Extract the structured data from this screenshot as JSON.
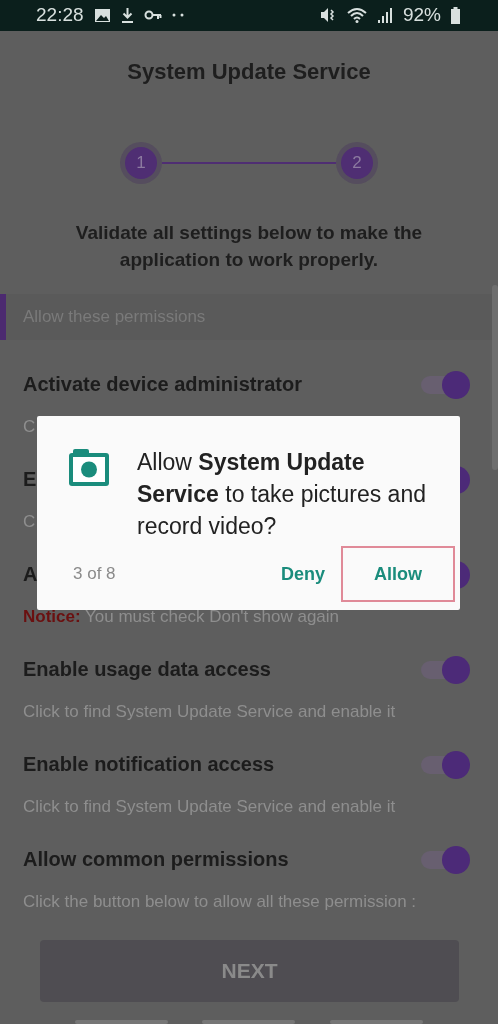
{
  "status_bar": {
    "time": "22:28",
    "battery": "92%"
  },
  "app_title": "System Update Service",
  "steps": [
    "1",
    "2"
  ],
  "instruction": "Validate all settings below to make the application to work properly.",
  "section_header": "Allow these permissions",
  "settings": [
    {
      "title": "Activate device administrator",
      "description": "C",
      "on": true
    },
    {
      "title": "E",
      "description": "C",
      "on": true
    },
    {
      "title": "A",
      "notice_label": "Notice:",
      "notice": "You must check Don't show again",
      "on": true
    },
    {
      "title": "Enable usage data access",
      "description": "Click to find System Update Service and enable it",
      "on": true
    },
    {
      "title": "Enable notification access",
      "description": "Click to find System Update Service and enable it",
      "on": true
    },
    {
      "title": "Allow common permissions",
      "description": "Click the button below to allow all these permission :",
      "on": true
    }
  ],
  "next_button": {
    "label": "NEXT",
    "disabled": true
  },
  "dialog": {
    "message": "Allow **System Update Service** to take pictures and record video?",
    "counter": "3 of 8",
    "buttons": [
      {
        "label": "Deny",
        "focused": false
      },
      {
        "label": "Allow",
        "focused": true
      }
    ]
  }
}
